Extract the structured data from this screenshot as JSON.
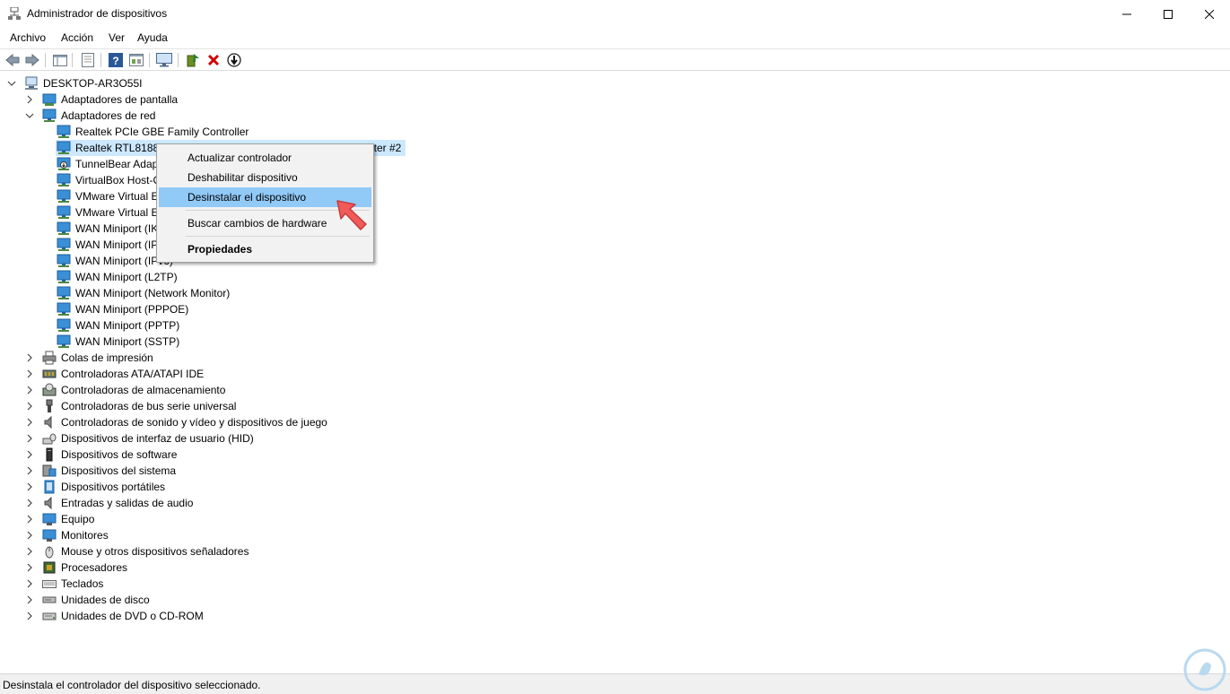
{
  "window": {
    "title": "Administrador de dispositivos"
  },
  "menubar": {
    "items": [
      "Archivo",
      "Acción",
      "Ver",
      "Ayuda"
    ]
  },
  "toolbar": {
    "buttons": [
      "back-arrow-icon",
      "forward-arrow-icon",
      "show-hide-tree-icon",
      "properties-icon",
      "help-icon",
      "view-icon",
      "monitor-icon",
      "update-driver-icon",
      "uninstall-icon",
      "disable-icon"
    ]
  },
  "tree": {
    "root": "DESKTOP-AR3O55I",
    "display_adapters": "Adaptadores de pantalla",
    "network_adapters": "Adaptadores de red",
    "network_children": [
      "Realtek PCIe GBE Family Controller",
      "Realtek RTL8188E",
      "TunnelBear Adap",
      "VirtualBox Host-C",
      "VMware Virtual E",
      "VMware Virtual E",
      "WAN Miniport (IK",
      "WAN Miniport (IP",
      "WAN Miniport (IPv6)",
      "WAN Miniport (L2TP)",
      "WAN Miniport (Network Monitor)",
      "WAN Miniport (PPPOE)",
      "WAN Miniport (PPTP)",
      "WAN Miniport (SSTP)"
    ],
    "selected_suffix": "pter #2",
    "categories": [
      "Colas de impresión",
      "Controladoras ATA/ATAPI IDE",
      "Controladoras de almacenamiento",
      "Controladoras de bus serie universal",
      "Controladoras de sonido y vídeo y dispositivos de juego",
      "Dispositivos de interfaz de usuario (HID)",
      "Dispositivos de software",
      "Dispositivos del sistema",
      "Dispositivos portátiles",
      "Entradas y salidas de audio",
      "Equipo",
      "Monitores",
      "Mouse y otros dispositivos señaladores",
      "Procesadores",
      "Teclados",
      "Unidades de disco",
      "Unidades de DVD o CD-ROM"
    ]
  },
  "context_menu": {
    "update": "Actualizar controlador",
    "disable": "Deshabilitar dispositivo",
    "uninstall": "Desinstalar el dispositivo",
    "scan": "Buscar cambios de hardware",
    "properties": "Propiedades"
  },
  "statusbar": {
    "text": "Desinstala el controlador del dispositivo seleccionado."
  },
  "colors": {
    "highlight": "#91c9f7",
    "selection": "#cce8ff",
    "accent_arrow": "#f25a5a"
  }
}
